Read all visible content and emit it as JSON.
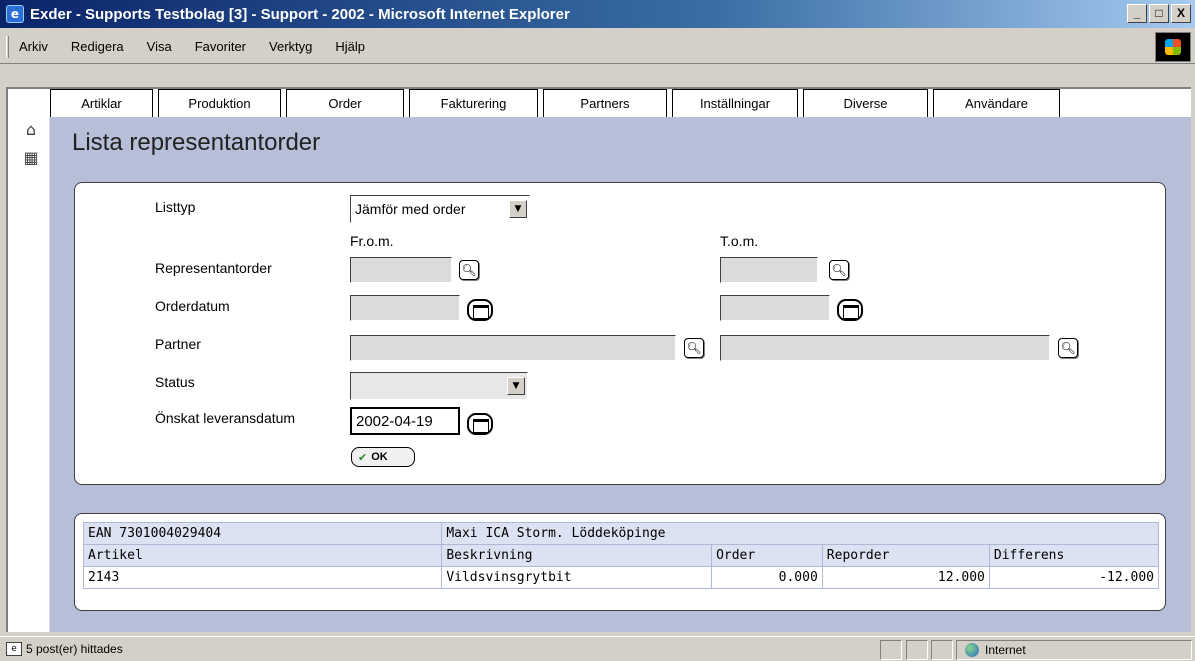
{
  "window": {
    "title": "Exder - Supports Testbolag [3] - Support - 2002 - Microsoft Internet Explorer",
    "controls": [
      "_",
      "□",
      "X"
    ]
  },
  "menu": [
    "Arkiv",
    "Redigera",
    "Visa",
    "Favoriter",
    "Verktyg",
    "Hjälp"
  ],
  "tabs": [
    "Artiklar",
    "Produktion",
    "Order",
    "Fakturering",
    "Partners",
    "Inställningar",
    "Diverse",
    "Användare"
  ],
  "sidebar_icons": [
    "home-icon",
    "grid-icon"
  ],
  "page": {
    "title": "Lista representantorder"
  },
  "form": {
    "listtyp_label": "Listtyp",
    "listtyp_value": "Jämför med order",
    "from_label": "Fr.o.m.",
    "to_label": "T.o.m.",
    "representantorder_label": "Representantorder",
    "orderdatum_label": "Orderdatum",
    "partner_label": "Partner",
    "status_label": "Status",
    "status_value": "",
    "leveransdatum_label": "Önskat leveransdatum",
    "leveransdatum_value": "2002-04-19",
    "ok_label": "OK"
  },
  "results": {
    "group_ean": "EAN 7301004029404",
    "group_name": "Maxi ICA Storm. Löddeköpinge",
    "columns": [
      "Artikel",
      "Beskrivning",
      "Order",
      "Reporder",
      "Differens"
    ],
    "rows": [
      {
        "artikel": "2143",
        "beskrivning": "Vildsvinsgrytbit",
        "order": "0.000",
        "reporder": "12.000",
        "differens": "-12.000"
      }
    ]
  },
  "status": {
    "message": "5 post(er) hittades",
    "zone": "Internet"
  }
}
